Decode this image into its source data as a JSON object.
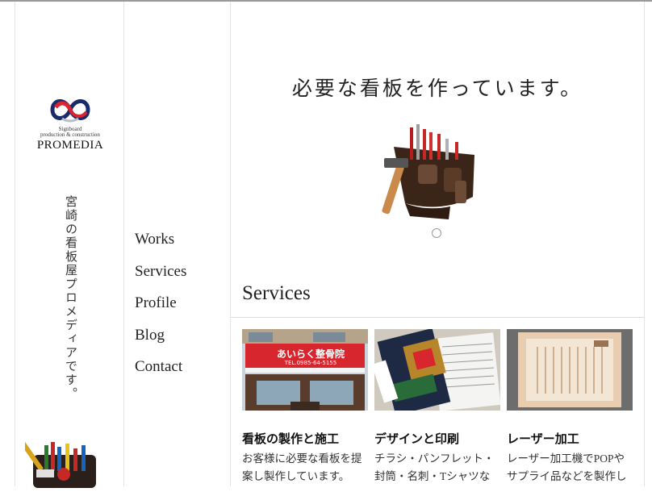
{
  "brand": {
    "tagline_line1": "Signboard",
    "tagline_line2": "production & construction",
    "name": "PROMEDIA"
  },
  "vertical_caption": "宮崎の看板屋プロメディアです。",
  "nav": [
    {
      "label": "Works"
    },
    {
      "label": "Services"
    },
    {
      "label": "Profile"
    },
    {
      "label": "Blog"
    },
    {
      "label": "Contact"
    }
  ],
  "hero": {
    "headline": "必要な看板を作っています。",
    "carousel_active_index": 0
  },
  "services": {
    "title": "Services",
    "cards": [
      {
        "title": "看板の製作と施工",
        "desc": "お客様に必要な看板を提案し製作しています。",
        "sign_text": "あいらく整骨院",
        "sign_tel": "TEL.0985-64-5155"
      },
      {
        "title": "デザインと印刷",
        "desc": "チラシ・パンフレット・封筒・名刺・Tシャツなどのデザイン"
      },
      {
        "title": "レーザー加工",
        "desc": "レーザー加工機でPOPやサプライ品などを製作していま"
      }
    ]
  },
  "colors": {
    "accent_red": "#d8262e",
    "accent_navy": "#1b2a6b",
    "border": "#e4e4e4"
  }
}
